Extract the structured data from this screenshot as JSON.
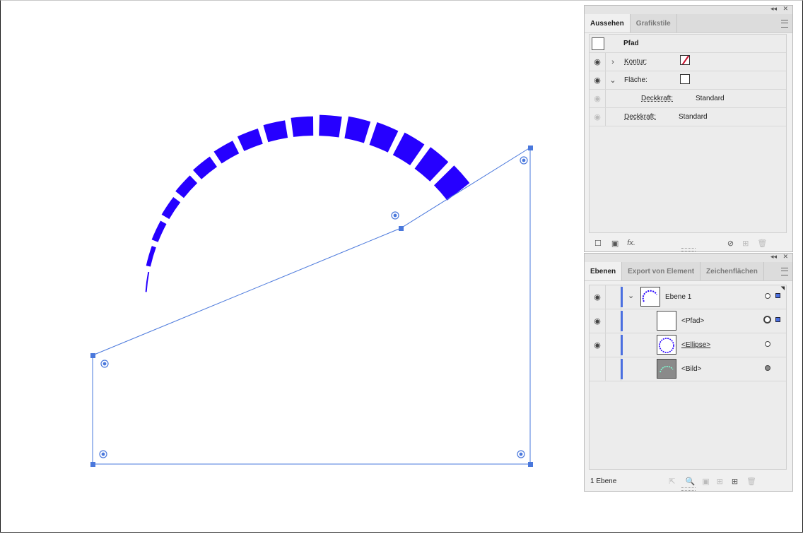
{
  "artwork": {
    "fill_color": "#2600ff",
    "selection_color": "#4a78dc"
  },
  "appearance_panel": {
    "tabs": [
      {
        "label": "Aussehen"
      },
      {
        "label": "Grafikstile"
      }
    ],
    "object_label": "Pfad",
    "rows": {
      "stroke": {
        "label": "Kontur:"
      },
      "fill": {
        "label": "Fläche:"
      },
      "fill_opacity": {
        "label": "Deckkraft:",
        "value": "Standard"
      },
      "opacity": {
        "label": "Deckkraft:",
        "value": "Standard"
      }
    },
    "footer_fx_label": "fx."
  },
  "layers_panel": {
    "tabs": [
      {
        "label": "Ebenen"
      },
      {
        "label": "Export von Element"
      },
      {
        "label": "Zeichenflächen"
      }
    ],
    "layers": [
      {
        "name": "Ebene 1"
      },
      {
        "name": "<Pfad>"
      },
      {
        "name": "<Ellipse>"
      },
      {
        "name": "<Bild>"
      }
    ],
    "footer_count": "1 Ebene"
  }
}
